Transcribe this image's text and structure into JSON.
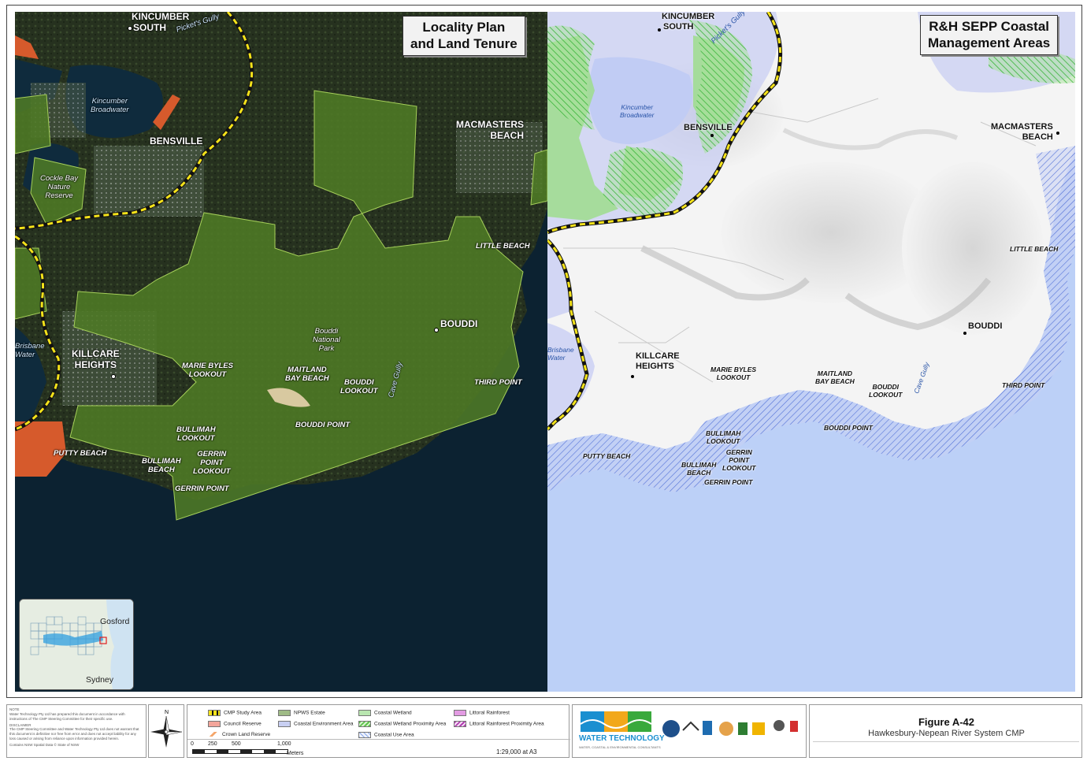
{
  "left_map": {
    "title_line1": "Locality Plan",
    "title_line2": "and Land Tenure",
    "labels": {
      "kincumber_south_1": "KINCUMBER",
      "kincumber_south_2": "SOUTH",
      "pickets_gully": "Picket's Gully",
      "kincumber_broadwater_1": "Kincumber",
      "kincumber_broadwater_2": "Broadwater",
      "bensville": "BENSVILLE",
      "macmasters_1": "MACMASTERS",
      "macmasters_2": "BEACH",
      "cockle_1": "Cockle Bay",
      "cockle_2": "Nature",
      "cockle_3": "Reserve",
      "little_beach": "LITTLE BEACH",
      "bouddi_np_1": "Bouddi",
      "bouddi_np_2": "National",
      "bouddi_np_3": "Park",
      "bouddi": "BOUDDI",
      "brisbane_water_1": "Brisbane",
      "brisbane_water_2": "Water",
      "killcare_1": "KILLCARE",
      "killcare_2": "HEIGHTS",
      "marie_byles_1": "MARIE BYLES",
      "marie_byles_2": "LOOKOUT",
      "maitland_1": "MAITLAND",
      "maitland_2": "BAY BEACH",
      "bouddi_lookout_1": "BOUDDI",
      "bouddi_lookout_2": "LOOKOUT",
      "cave_gully": "Cave Gully",
      "third_point": "THIRD POINT",
      "bouddi_point": "BOUDDI POINT",
      "bullimah_lookout_1": "BULLIMAH",
      "bullimah_lookout_2": "LOOKOUT",
      "putty_beach": "PUTTY BEACH",
      "bullimah_beach_1": "BULLIMAH",
      "bullimah_beach_2": "BEACH",
      "gerrin_lookout_1": "GERRIN",
      "gerrin_lookout_2": "POINT",
      "gerrin_lookout_3": "LOOKOUT",
      "gerrin_point": "GERRIN POINT"
    }
  },
  "right_map": {
    "title_line1": "R&H SEPP Coastal",
    "title_line2": "Management Areas"
  },
  "inset": {
    "gosford": "Gosford",
    "sydney": "Sydney"
  },
  "legend": {
    "items": [
      {
        "label": "CMP Study Area",
        "color": "#f5e31a"
      },
      {
        "label": "Council Reserve",
        "color": "#f08070"
      },
      {
        "label": "Crown Land Reserve",
        "color": "#f4a66b"
      },
      {
        "label": "NPWS Estate",
        "color": "#7aa85a"
      },
      {
        "label": "Coastal Environment Area",
        "color": "#c8cff2"
      },
      {
        "label": "Coastal Wetland",
        "color": "#a6e0a0"
      },
      {
        "label": "Coastal Wetland Proximity Area",
        "color": "#5ec34a"
      },
      {
        "label": "Coastal Use Area",
        "color": "#8aa8e8"
      },
      {
        "label": "Littoral Rainforest",
        "color": "#d86ad8"
      },
      {
        "label": "Littoral Rainforest Proximity Area",
        "color": "#b03fb0"
      }
    ]
  },
  "scale": {
    "ticks": [
      "0",
      "250",
      "500",
      "1,000"
    ],
    "units": "Meters",
    "ratio": "1:29,000 at A3"
  },
  "figure": {
    "number": "Figure A-42",
    "caption": "Hawkesbury-Nepean River System CMP"
  },
  "logo": {
    "line1": "WATER TECHNOLOGY",
    "line2": "WATER, COASTAL & ENVIRONMENTAL CONSULTANTS"
  },
  "notes": {
    "note_head": "NOTE",
    "note_text": "Water Technology Pty Ltd has prepared this document in accordance with instructions of The CMP Steering Committee for their specific use.",
    "disclaimer_head": "DISCLAIMER",
    "disclaimer_text": "The CMP Steering Committee and Water Technology Pty Ltd does not warrant that this document is definitive nor free from error and does not accept liability for any loss caused or arising from reliance upon information provided herein.",
    "credit": "Contains NSW Spatial Data © State of NSW"
  },
  "colors": {
    "satellite_bg": "#0d1f2b",
    "npws_green": "#4e7a25",
    "cmp_yellow": "#f5e31a",
    "cea_blue": "#b9c6f0",
    "ocean_right": "#b9cff8"
  }
}
